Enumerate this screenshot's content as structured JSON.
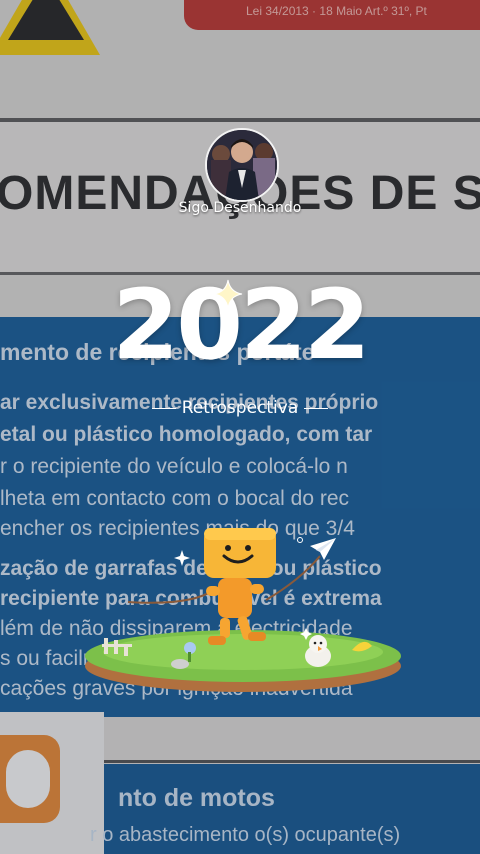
{
  "background": {
    "sign_small_text": "Lei 34/2013 · 18 Maio Art.º 31º, Pt",
    "heading": "OMENDAÇÕES DE S",
    "blue_lines": [
      "mento de recipientes portáte",
      "ar exclusivamente recipientes próprio",
      "etal ou plástico homologado, com tar",
      "r o recipiente do veículo e colocá-lo n",
      "lheta em contacto com o bocal do rec",
      "encher os recipientes mais do que 3/4",
      "zação de garrafas de vidro ou plástico",
      "recipiente para combustível é extrema",
      "lém de não dissiparem a electricidade",
      "s ou facilmente combustíveis",
      "cações graves por ignição inadvertida"
    ],
    "lower_heading": "nto de motos",
    "lower_line": "r o abastecimento o(s) ocupante(s)"
  },
  "profile": {
    "username": "Sigo Desenhando"
  },
  "recap": {
    "year": "2022",
    "subtitle": "Retrospectiva"
  },
  "icons": {
    "sparkle": "sparkle-icon",
    "paper_plane": "paper-plane-icon",
    "mascot": "box-head-mascot-icon"
  },
  "colors": {
    "sign_blue": "#1d5f97",
    "mascot_orange": "#f6a531",
    "grass_green": "#7cc04a"
  }
}
